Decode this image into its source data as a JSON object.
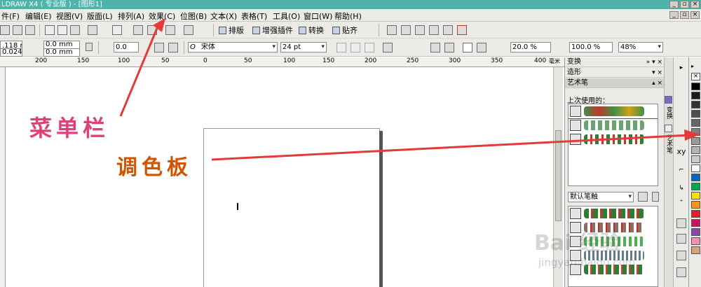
{
  "window": {
    "title": "LDRAW X4 ( 专业版 ) - [图形1]",
    "controls": [
      "_",
      "▫",
      "×"
    ]
  },
  "menubar": {
    "items": [
      {
        "label": "件(F)"
      },
      {
        "label": "编辑(E)"
      },
      {
        "label": "视图(V)"
      },
      {
        "label": "版面(L)"
      },
      {
        "label": "排列(A)"
      },
      {
        "label": "效果(C)"
      },
      {
        "label": "位图(B)"
      },
      {
        "label": "文本(X)"
      },
      {
        "label": "表格(T)"
      },
      {
        "label": "工具(O)"
      },
      {
        "label": "窗口(W)"
      },
      {
        "label": "帮助(H)"
      }
    ]
  },
  "toolbar1": {
    "buttons": [
      {
        "label": "排版"
      },
      {
        "label": "增强插件"
      },
      {
        "label": "转换"
      },
      {
        "label": "贴齐"
      }
    ]
  },
  "property_bar": {
    "width_value": ".118 mm",
    "height_value": "0.024 mm",
    "x_value": "0.0 mm",
    "y_value": "0.0 mm",
    "rotation_value": "0.0",
    "font_name": "宋体",
    "font_size": "24 pt",
    "char_spacing": "20.0 %",
    "line_spacing": "100.0 %",
    "zoom": "48%"
  },
  "ruler": {
    "ticks": [
      "200",
      "150",
      "100",
      "50",
      "0",
      "50",
      "100",
      "150",
      "200",
      "250",
      "300",
      "350",
      "400"
    ],
    "unit": "毫米"
  },
  "docker": {
    "panels": [
      {
        "title": "变换"
      },
      {
        "title": "造形"
      },
      {
        "title": "艺术笔"
      }
    ],
    "recent_label": "上次使用的：",
    "preset_dropdown": "默认笔触",
    "side_tabs": [
      "变换",
      "造形",
      "艺术笔"
    ]
  },
  "toolbox": {
    "labels": [
      "▸",
      "xy",
      "⌐",
      "↳",
      "⁺"
    ]
  },
  "palette": {
    "colors": [
      "#000000",
      "#1a1a1a",
      "#333333",
      "#4d4d4d",
      "#666666",
      "#808080",
      "#999999",
      "#b3b3b3",
      "#cccccc",
      "#ffffff",
      "#0066cc",
      "#00a651",
      "#ffde00",
      "#f7941d",
      "#ed1c24",
      "#c2185b",
      "#8e44ad",
      "#f48fb1",
      "#d2a679"
    ]
  },
  "annotations": {
    "menu_label": "菜单栏",
    "palette_label": "调色板",
    "menu_color": "#e0407a",
    "palette_color": "#d35400",
    "arrow_color": "#e33a3a"
  },
  "watermark": {
    "brand": "Bai 经验",
    "url": "jingyan.baidu.com"
  }
}
